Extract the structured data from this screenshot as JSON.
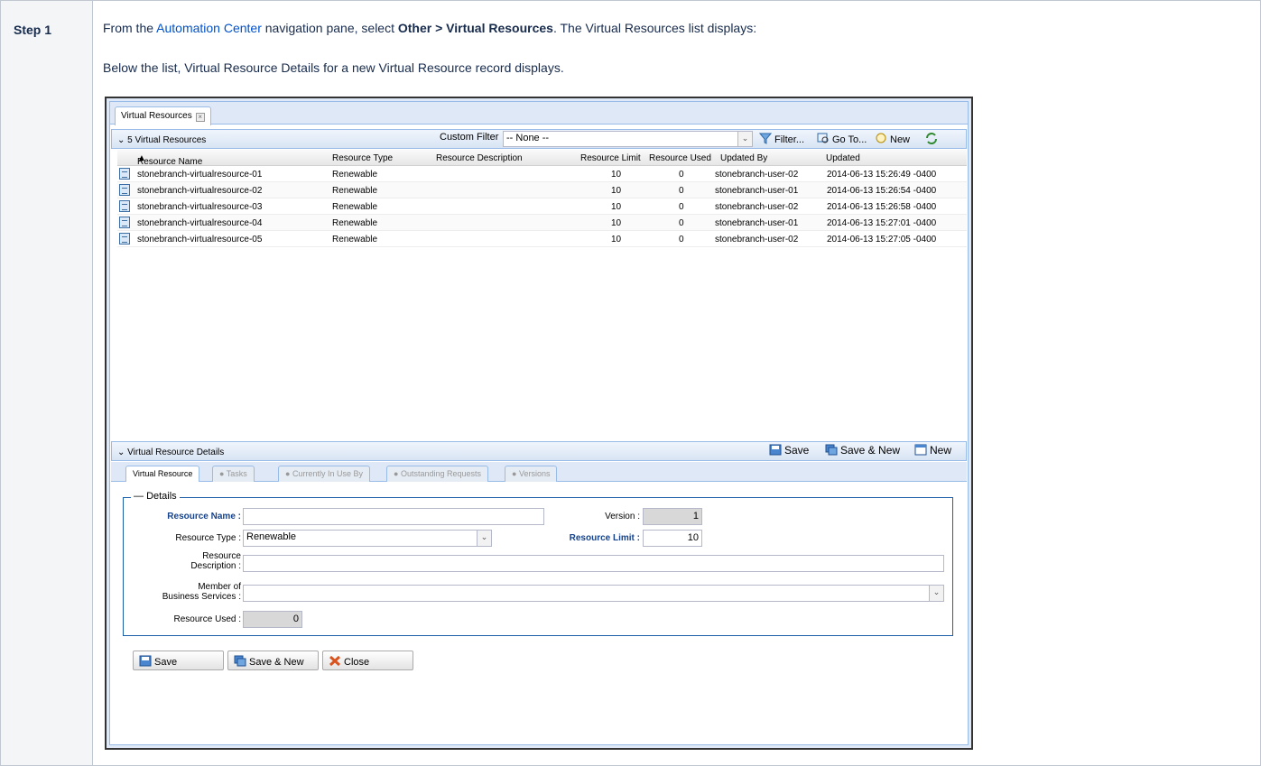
{
  "doc": {
    "step_label": "Step 1",
    "line1_pre": "From the ",
    "line1_link": "Automation Center",
    "line1_mid": " navigation pane, select ",
    "line1_bold": "Other > Virtual Resources",
    "line1_post": ". The Virtual Resources list displays:",
    "line2": "Below the list, Virtual Resource Details for a new Virtual Resource record displays."
  },
  "app": {
    "main_tab": "Virtual Resources",
    "list_title": "5 Virtual Resources",
    "custom_filter_label": "Custom Filter",
    "custom_filter_value": "-- None --",
    "toolbar": {
      "filter": "Filter...",
      "goto": "Go To...",
      "new": "New"
    },
    "columns": [
      "Resource Name",
      "Resource Type",
      "Resource Description",
      "Resource Limit",
      "Resource Used",
      "Updated By",
      "Updated"
    ],
    "rows": [
      {
        "name": "stonebranch-virtualresource-01",
        "type": "Renewable",
        "desc": "",
        "limit": "10",
        "used": "0",
        "by": "stonebranch-user-02",
        "updated": "2014-06-13 15:26:49 -0400"
      },
      {
        "name": "stonebranch-virtualresource-02",
        "type": "Renewable",
        "desc": "",
        "limit": "10",
        "used": "0",
        "by": "stonebranch-user-01",
        "updated": "2014-06-13 15:26:54 -0400"
      },
      {
        "name": "stonebranch-virtualresource-03",
        "type": "Renewable",
        "desc": "",
        "limit": "10",
        "used": "0",
        "by": "stonebranch-user-02",
        "updated": "2014-06-13 15:26:58 -0400"
      },
      {
        "name": "stonebranch-virtualresource-04",
        "type": "Renewable",
        "desc": "",
        "limit": "10",
        "used": "0",
        "by": "stonebranch-user-01",
        "updated": "2014-06-13 15:27:01 -0400"
      },
      {
        "name": "stonebranch-virtualresource-05",
        "type": "Renewable",
        "desc": "",
        "limit": "10",
        "used": "0",
        "by": "stonebranch-user-02",
        "updated": "2014-06-13 15:27:05 -0400"
      }
    ],
    "details": {
      "title": "Virtual Resource Details",
      "header_buttons": {
        "save": "Save",
        "save_new": "Save & New",
        "new": "New"
      },
      "tabs": [
        "Virtual Resource",
        "Tasks",
        "Currently In Use By",
        "Outstanding Requests",
        "Versions"
      ],
      "legend": "Details",
      "labels": {
        "resource_name": "Resource Name :",
        "version": "Version :",
        "resource_type": "Resource Type :",
        "resource_limit": "Resource Limit :",
        "desc_1": "Resource",
        "desc_2": "Description :",
        "member_1": "Member of",
        "member_2": "Business Services :",
        "resource_used": "Resource Used :"
      },
      "values": {
        "resource_name": "",
        "version": "1",
        "resource_type": "Renewable",
        "resource_limit": "10",
        "description": "",
        "business_services": "",
        "resource_used": "0"
      },
      "buttons": {
        "save": "Save",
        "save_new": "Save & New",
        "close": "Close"
      }
    }
  },
  "colors": {
    "link": "#0052cc",
    "panel_border": "#99bbe8",
    "required_label": "#15428b",
    "fieldset_border": "#1c5fa8"
  }
}
